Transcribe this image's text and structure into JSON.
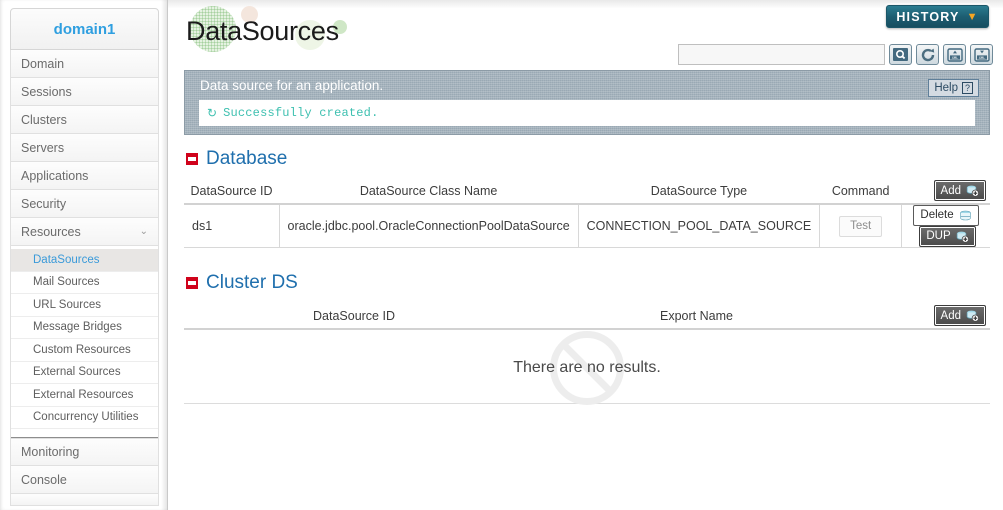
{
  "sidebar": {
    "domain_label": "domain1",
    "items": [
      {
        "label": "Domain",
        "expandable": false
      },
      {
        "label": "Sessions",
        "expandable": false
      },
      {
        "label": "Clusters",
        "expandable": false
      },
      {
        "label": "Servers",
        "expandable": false
      },
      {
        "label": "Applications",
        "expandable": false
      },
      {
        "label": "Security",
        "expandable": false
      },
      {
        "label": "Resources",
        "expandable": true,
        "chevron": "⌄"
      }
    ],
    "sub_items": [
      {
        "label": "DataSources",
        "active": true
      },
      {
        "label": "Mail Sources",
        "active": false
      },
      {
        "label": "URL Sources",
        "active": false
      },
      {
        "label": "Message Bridges",
        "active": false
      },
      {
        "label": "Custom Resources",
        "active": false
      },
      {
        "label": "External Sources",
        "active": false
      },
      {
        "label": "External Resources",
        "active": false
      },
      {
        "label": "Concurrency Utilities",
        "active": false
      }
    ],
    "footer_items": [
      {
        "label": "Monitoring"
      },
      {
        "label": "Console"
      }
    ]
  },
  "header": {
    "page_title": "DataSources",
    "history_label": "HISTORY",
    "history_chevron": "▼"
  },
  "search": {
    "value": "",
    "placeholder": "",
    "icons": [
      {
        "name": "search-icon"
      },
      {
        "name": "refresh-icon"
      },
      {
        "name": "xml-import-icon"
      },
      {
        "name": "xml-export-icon"
      }
    ]
  },
  "banner": {
    "title": "Data source for an application.",
    "help_label": "Help",
    "help_glyph": "?",
    "message": "Successfully created.",
    "message_icon": "↻",
    "message_color": "#3ec0b0",
    "background_color": "#9aa9b4"
  },
  "database_section": {
    "title": "Database",
    "marker_color": "#d0021b",
    "columns": [
      "DataSource ID",
      "DataSource Class Name",
      "DataSource Type",
      "Command"
    ],
    "add_label": "Add",
    "rows": [
      {
        "datasource_id": "ds1",
        "class_name": "oracle.jdbc.pool.OracleConnectionPoolDataSource",
        "type": "CONNECTION_POOL_DATA_SOURCE",
        "command": "Test",
        "delete_label": "Delete",
        "dup_label": "DUP"
      }
    ]
  },
  "cluster_section": {
    "title": "Cluster DS",
    "marker_color": "#d0021b",
    "columns": [
      "DataSource ID",
      "Export Name"
    ],
    "add_label": "Add",
    "empty_message": "There are no results."
  }
}
